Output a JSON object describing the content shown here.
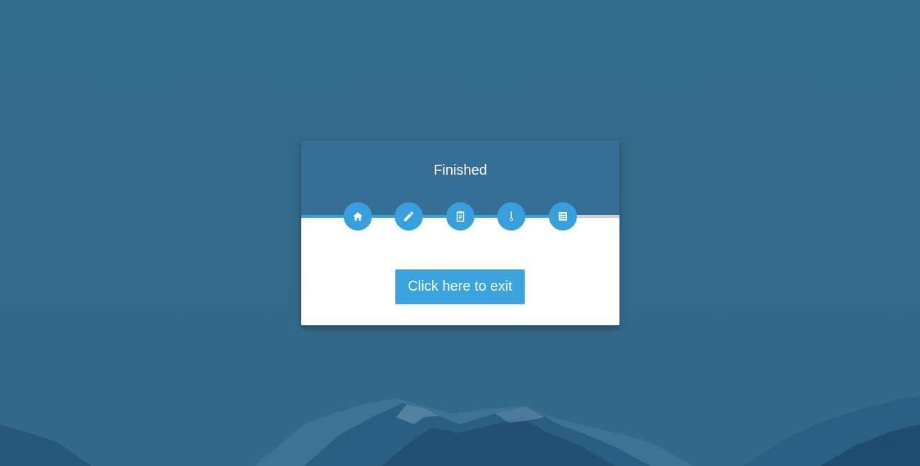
{
  "wizard": {
    "title": "Finished",
    "progress_fraction": 0.86,
    "steps": [
      {
        "icon": "home-icon"
      },
      {
        "icon": "pencil-icon"
      },
      {
        "icon": "clipboard-icon"
      },
      {
        "icon": "thermometer-icon"
      },
      {
        "icon": "list-icon"
      }
    ],
    "exit_button_label": "Click here to exit"
  },
  "colors": {
    "background": "#346c8c",
    "header": "#356f95",
    "accent": "#37a0dc",
    "card": "#ffffff"
  }
}
